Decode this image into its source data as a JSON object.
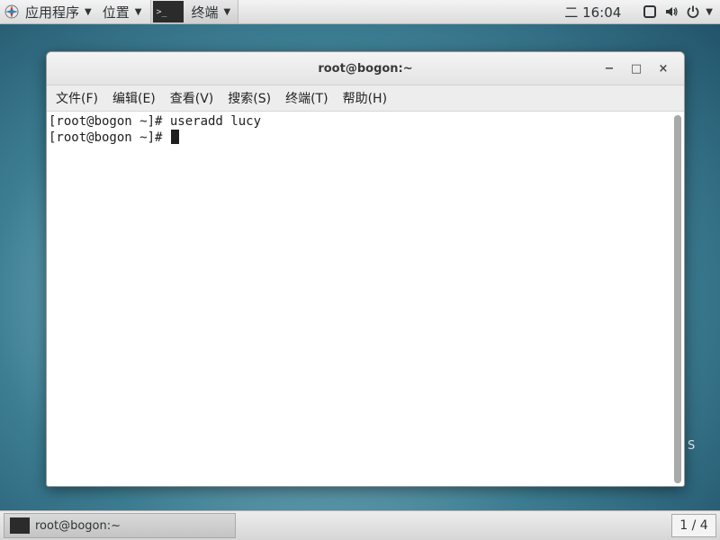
{
  "top_panel": {
    "apps_menu_label": "应用程序",
    "places_menu_label": "位置",
    "task_label": "终端",
    "clock": "二 16:04",
    "icons": [
      "apps-icon",
      "screen-icon",
      "volume-icon",
      "power-icon"
    ]
  },
  "window": {
    "title": "root@bogon:~",
    "controls": {
      "minimize": "−",
      "maximize": "□",
      "close": "×"
    },
    "menu": [
      "文件(F)",
      "编辑(E)",
      "查看(V)",
      "搜索(S)",
      "终端(T)",
      "帮助(H)"
    ],
    "terminal_lines": [
      "[root@bogon ~]# useradd lucy",
      "[root@bogon ~]# "
    ]
  },
  "desktop": {
    "watermark": "S"
  },
  "bottom_panel": {
    "task_label": "root@bogon:~",
    "workspace": "1 / 4"
  },
  "colors": {
    "accent": "#2e3436",
    "terminal_bg": "#ffffff",
    "terminal_fg": "#1e1e1e"
  }
}
